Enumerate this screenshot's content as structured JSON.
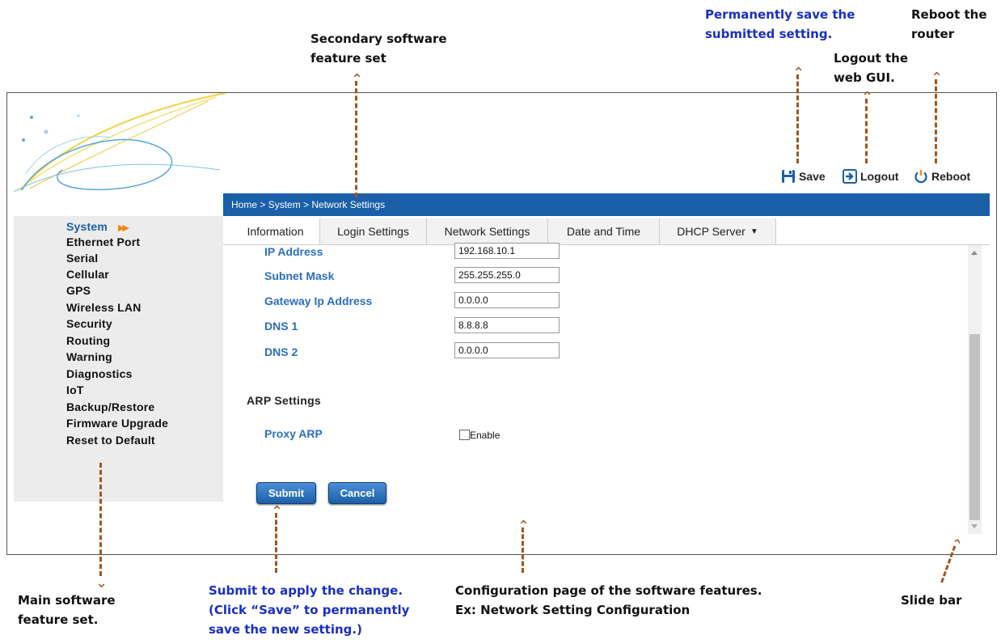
{
  "annotations": {
    "secondary_feature_set": [
      "Secondary software",
      "feature set"
    ],
    "save_hint": [
      "Permanently save the",
      "submitted setting."
    ],
    "reboot_hint": [
      "Reboot the",
      "router"
    ],
    "logout_hint": [
      "Logout the",
      "web GUI."
    ],
    "main_feature_set": [
      "Main software",
      "feature set."
    ],
    "submit_hint": [
      "Submit to apply the change.",
      "(Click “Save” to permanently",
      "save the new setting.)"
    ],
    "config_page_hint": [
      "Configuration page of the software features.",
      "Ex: Network Setting Configuration"
    ],
    "slide_bar": "Slide bar"
  },
  "header": {
    "save_label": "Save",
    "logout_label": "Logout",
    "reboot_label": "Reboot"
  },
  "breadcrumb": "Home > System > Network Settings",
  "sidebar": {
    "items": [
      "System",
      "Ethernet Port",
      "Serial",
      "Cellular",
      "GPS",
      "Wireless LAN",
      "Security",
      "Routing",
      "Warning",
      "Diagnostics",
      "IoT",
      "Backup/Restore",
      "Firmware Upgrade",
      "Reset to Default"
    ]
  },
  "tabs": [
    "Information",
    "Login Settings",
    "Network Settings",
    "Date and Time",
    "DHCP Server"
  ],
  "form": {
    "ip_address": {
      "label": "IP Address",
      "value": "192.168.10.1"
    },
    "subnet_mask": {
      "label": "Subnet Mask",
      "value": "255.255.255.0"
    },
    "gateway": {
      "label": "Gateway Ip Address",
      "value": "0.0.0.0"
    },
    "dns1": {
      "label": "DNS 1",
      "value": "8.8.8.8"
    },
    "dns2": {
      "label": "DNS 2",
      "value": "0.0.0.0"
    }
  },
  "arp": {
    "title": "ARP Settings",
    "proxy_label": "Proxy ARP",
    "enable_label": "Enable"
  },
  "buttons": {
    "submit": "Submit",
    "cancel": "Cancel"
  },
  "colors": {
    "accent": "#1a5fa8",
    "label_blue": "#2a6fbf",
    "annotation_blue": "#1a2fbf",
    "arrow_brown": "#a0561a"
  }
}
